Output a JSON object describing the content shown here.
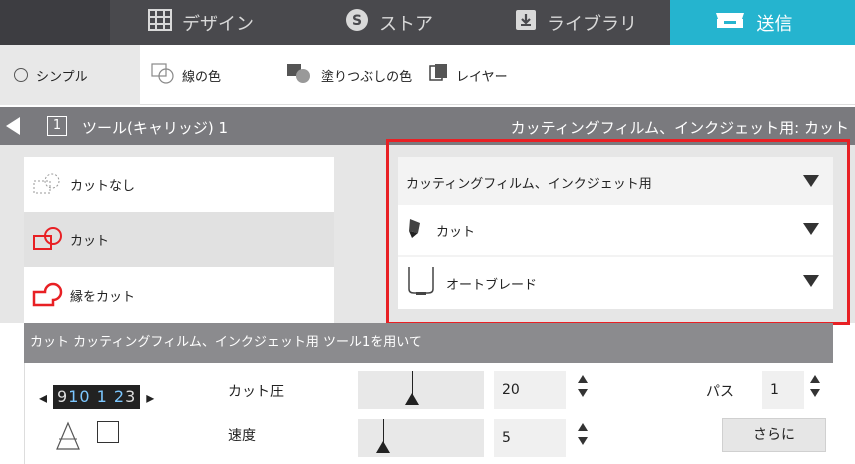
{
  "tabs": [
    {
      "label": "デザイン",
      "icon": "grid-icon"
    },
    {
      "label": "ストア",
      "icon": "store-s-icon"
    },
    {
      "label": "ライブラリ",
      "icon": "download-box-icon"
    },
    {
      "label": "送信",
      "icon": "send-machine-icon",
      "active": true
    }
  ],
  "toolbar": {
    "simple": "シンプル",
    "line_color": "線の色",
    "fill_color": "塗りつぶしの色",
    "layer": "レイヤー"
  },
  "tool_header": {
    "tool_number": "1",
    "label": "ツール(キャリッジ)  1",
    "material_summary": "カッティングフィルム、インクジェット用: カット"
  },
  "cut_options": [
    {
      "label": "カットなし",
      "icon": "no-cut-icon"
    },
    {
      "label": "カット",
      "icon": "cut-icon",
      "selected": true
    },
    {
      "label": "縁をカット",
      "icon": "edge-cut-icon"
    }
  ],
  "material_panel": {
    "material": "カッティングフィルム、インクジェット用",
    "action": "カット",
    "blade": "オートブレード"
  },
  "status": "カット カッティングフィルム、インクジェット用 ツール1を用いて",
  "controls": {
    "depth_left": "9",
    "depth_values": "10 1 2",
    "depth_right": "3",
    "force_label": "カット圧",
    "force_value": "20",
    "force_level": 0.43,
    "speed_label": "速度",
    "speed_value": "5",
    "speed_level": 0.2,
    "passes_label": "パス",
    "passes_value": "1",
    "more_label": "さらに"
  },
  "colors": {
    "accent": "#25b4cf",
    "highlight": "#e82024",
    "cut_red": "#e82024"
  }
}
